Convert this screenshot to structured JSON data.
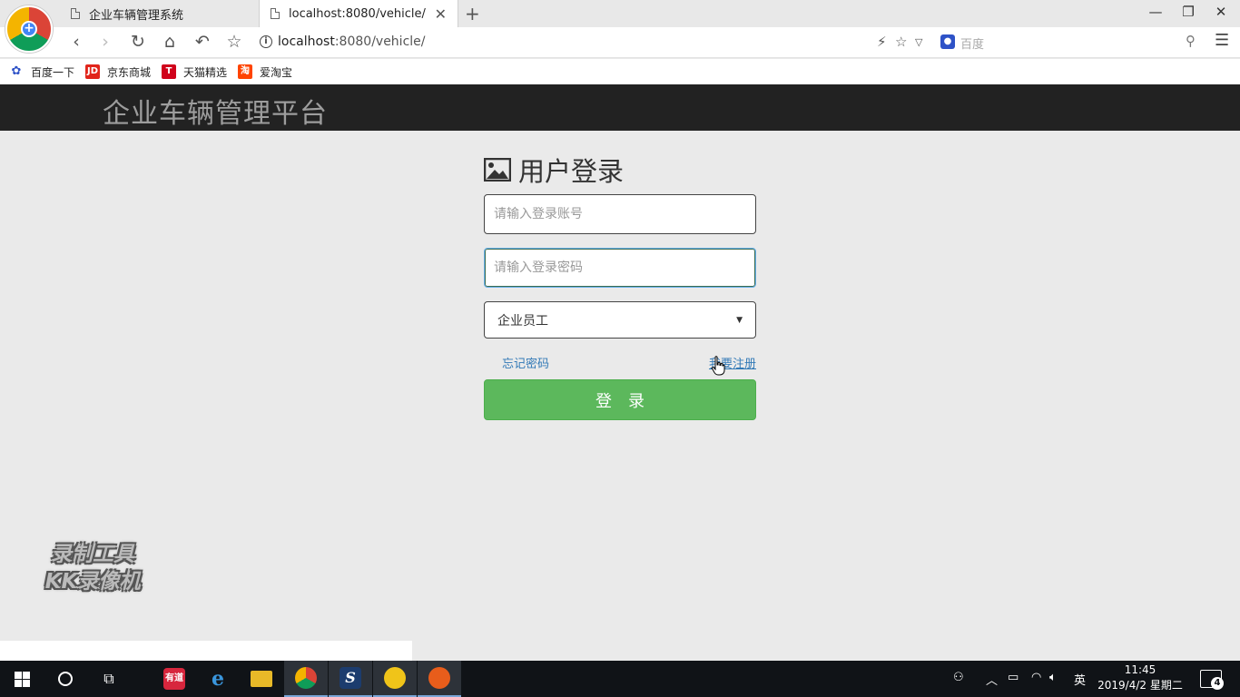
{
  "browser": {
    "tabs": [
      {
        "title": "企业车辆管理系统",
        "active": false
      },
      {
        "title": "localhost:8080/vehicle/",
        "active": true
      }
    ],
    "url_host": "localhost",
    "url_rest": ":8080/vehicle/",
    "search_placeholder": "百度",
    "bookmarks": [
      {
        "label": "百度一下",
        "icon": "baidu-paw-icon",
        "color": "#2e52c7"
      },
      {
        "label": "京东商城",
        "icon": "jd-icon",
        "color": "#e1251b",
        "badge": "JD"
      },
      {
        "label": "天猫精选",
        "icon": "tmall-icon",
        "color": "#d0021b",
        "badge": "T"
      },
      {
        "label": "爱淘宝",
        "icon": "taobao-icon",
        "color": "#ff4400",
        "badge": "淘"
      }
    ]
  },
  "app": {
    "title": "企业车辆管理平台"
  },
  "login": {
    "title": "用户登录",
    "username_placeholder": "请输入登录账号",
    "password_placeholder": "请输入登录密码",
    "role_selected": "企业员工",
    "forgot_link": "忘记密码",
    "register_link": "我要注册",
    "submit_label": "登录",
    "button_color": "#5cb85c"
  },
  "watermark": {
    "line1": "录制工具",
    "line2": "KK录像机"
  },
  "taskbar": {
    "clock_time": "11:45",
    "clock_date": "2019/4/2 星期二",
    "ime": "英",
    "notification_count": "4",
    "pinned_badge": "有道"
  }
}
